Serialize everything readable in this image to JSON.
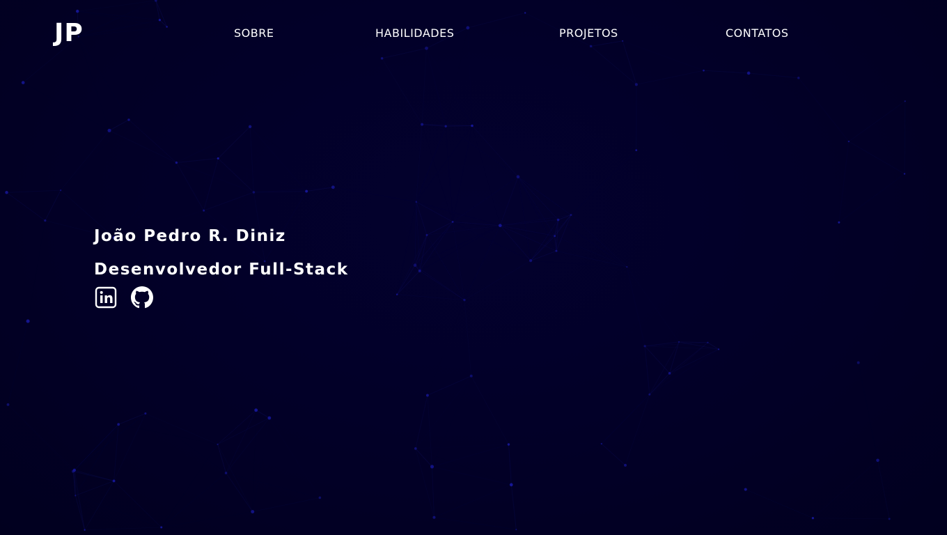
{
  "header": {
    "logo": "JP",
    "nav": [
      {
        "label": "SOBRE"
      },
      {
        "label": "HABILIDADES"
      },
      {
        "label": "PROJETOS"
      },
      {
        "label": "CONTATOS"
      }
    ]
  },
  "hero": {
    "name": "João Pedro R. Diniz",
    "role": "Desenvolvedor Full-Stack",
    "social": [
      {
        "icon": "linkedin-icon"
      },
      {
        "icon": "github-icon"
      }
    ]
  },
  "colors": {
    "background": "#02002a",
    "text": "#ffffff",
    "particle": "#1a1aa8"
  }
}
